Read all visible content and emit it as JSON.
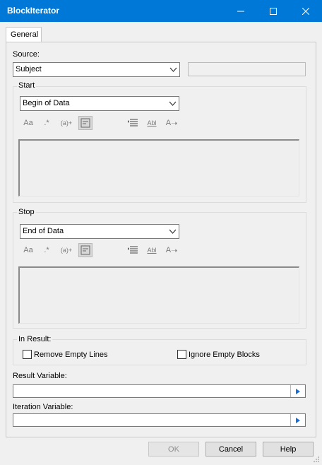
{
  "window": {
    "title": "BlockIterator"
  },
  "tabs": [
    {
      "label": "General"
    }
  ],
  "source": {
    "label": "Source:",
    "selected": "Subject",
    "side_value": ""
  },
  "start": {
    "label": "Start",
    "selected": "Begin of Data",
    "toolbar": [
      {
        "icon": "match-case-icon",
        "glyph": "Aa"
      },
      {
        "icon": "regex-icon",
        "glyph": ".*"
      },
      {
        "icon": "group-icon",
        "glyph": "(a)+"
      },
      {
        "icon": "wildcard-icon",
        "glyph": "",
        "active": true
      },
      {
        "icon": "list-icon",
        "glyph": ""
      },
      {
        "icon": "whole-word-icon",
        "glyph": "Abl"
      },
      {
        "icon": "replace-icon",
        "glyph": "A"
      }
    ],
    "text": ""
  },
  "stop": {
    "label": "Stop",
    "selected": "End of Data",
    "text": ""
  },
  "result_group": {
    "label": "In Result:",
    "remove_empty_lines": "Remove Empty Lines",
    "ignore_empty_blocks": "Ignore Empty Blocks"
  },
  "result_variable": {
    "label": "Result Variable:",
    "value": ""
  },
  "iteration_variable": {
    "label": "Iteration Variable:",
    "value": ""
  },
  "buttons": {
    "ok": "OK",
    "cancel": "Cancel",
    "help": "Help"
  },
  "colors": {
    "titlebar": "#0078d7",
    "arrow_blue": "#1a6fd6"
  }
}
